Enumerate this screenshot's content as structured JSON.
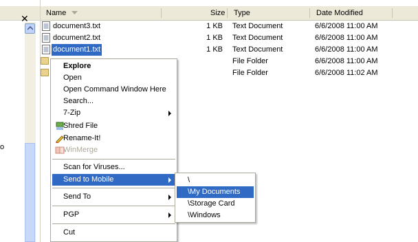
{
  "leftpanel": {
    "close_glyph": "✕",
    "edge_mark": "o"
  },
  "header": {
    "name": "Name",
    "size": "Size",
    "type": "Type",
    "date": "Date Modified",
    "sort_icon": "sort-desc-icon"
  },
  "files": [
    {
      "name": "document3.txt",
      "size": "1 KB",
      "type": "Text Document",
      "date": "6/6/2008 11:00 AM",
      "icon": "text-file-icon"
    },
    {
      "name": "document2.txt",
      "size": "1 KB",
      "type": "Text Document",
      "date": "6/6/2008 11:00 AM",
      "icon": "text-file-icon"
    },
    {
      "name": "document1.txt",
      "size": "1 KB",
      "type": "Text Document",
      "date": "6/6/2008 11:00 AM",
      "icon": "text-file-icon",
      "selected": true
    },
    {
      "name": "",
      "size": "",
      "type": "File Folder",
      "date": "6/6/2008 11:00 AM",
      "icon": "folder-icon"
    },
    {
      "name": "",
      "size": "",
      "type": "File Folder",
      "date": "6/6/2008 11:02 AM",
      "icon": "folder-icon"
    }
  ],
  "context_menu": {
    "items": [
      {
        "label": "Explore"
      },
      {
        "label": "Open"
      },
      {
        "label": "Open Command Window Here"
      },
      {
        "label": "Search..."
      },
      {
        "label": "7-Zip"
      },
      {
        "label": "Shred File",
        "icon": "shred-icon"
      },
      {
        "label": "Rename-It!",
        "icon": "rename-icon"
      },
      {
        "label": "WinMerge",
        "icon": "winmerge-icon"
      },
      {
        "label": "Scan for Viruses..."
      },
      {
        "label": "Send to Mobile"
      },
      {
        "label": "Send To"
      },
      {
        "label": "PGP"
      },
      {
        "label": "Cut"
      }
    ]
  },
  "submenu": {
    "items": [
      {
        "label": "\\"
      },
      {
        "label": "\\My Documents"
      },
      {
        "label": "\\Storage Card"
      },
      {
        "label": "\\Windows"
      }
    ]
  },
  "colors": {
    "selection": "#316ac5",
    "header_bg": "#ece9d8",
    "menu_border": "#aca899",
    "disabled_text": "#aca899"
  }
}
